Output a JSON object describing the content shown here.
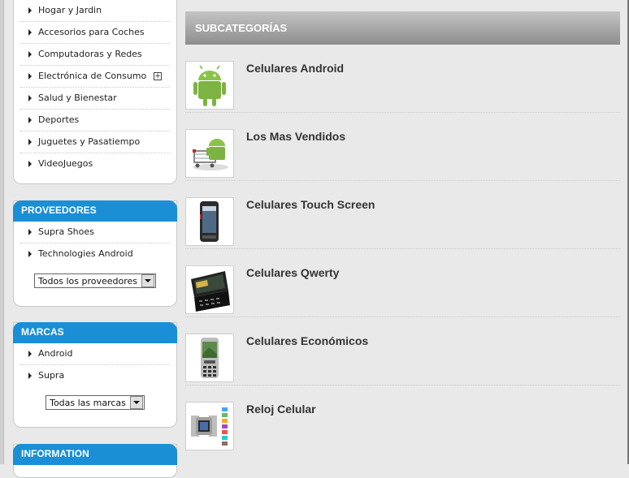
{
  "sidebar": {
    "categories": [
      {
        "label": "Hogar y Jardin"
      },
      {
        "label": "Accesorios para Coches"
      },
      {
        "label": "Computadoras y Redes"
      },
      {
        "label": "Electrónica de Consumo",
        "expand": "+"
      },
      {
        "label": "Salud y Bienestar"
      },
      {
        "label": "Deportes"
      },
      {
        "label": "Juguetes y Pasatiempo"
      },
      {
        "label": "VideoJuegos"
      }
    ],
    "proveedores": {
      "title": "PROVEEDORES",
      "items": [
        {
          "label": "Supra Shoes"
        },
        {
          "label": "Technologies Android"
        }
      ],
      "select_value": "Todos los proveedores"
    },
    "marcas": {
      "title": "MARCAS",
      "items": [
        {
          "label": "Android"
        },
        {
          "label": "Supra"
        }
      ],
      "select_value": "Todas las marcas"
    },
    "information": {
      "title": "INFORMATION"
    }
  },
  "main": {
    "header": "SUBCATEGORÍAS",
    "subcategories": [
      {
        "title": "Celulares Android",
        "icon": "android-robot-icon"
      },
      {
        "title": "Los Mas Vendidos",
        "icon": "android-shopping-cart-icon"
      },
      {
        "title": "Celulares Touch Screen",
        "icon": "touch-phone-icon"
      },
      {
        "title": "Celulares Qwerty",
        "icon": "qwerty-phone-icon"
      },
      {
        "title": "Celulares Económicos",
        "icon": "candybar-phone-icon"
      },
      {
        "title": "Reloj Celular",
        "icon": "watch-phone-icon"
      }
    ]
  },
  "colors": {
    "accent": "#1a8fd6",
    "android_green": "#8bc34a"
  }
}
